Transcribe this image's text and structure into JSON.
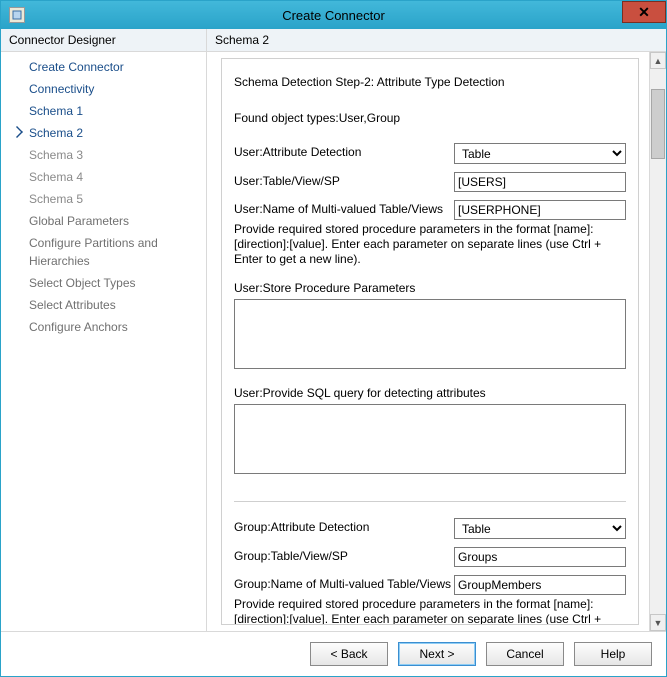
{
  "window": {
    "title": "Create Connector"
  },
  "headers": {
    "left": "Connector Designer",
    "right": "Schema 2"
  },
  "sidebar": {
    "items": [
      {
        "label": "Create Connector",
        "kind": "link"
      },
      {
        "label": "Connectivity",
        "kind": "link"
      },
      {
        "label": "Schema 1",
        "kind": "link"
      },
      {
        "label": "Schema 2",
        "kind": "active"
      },
      {
        "label": "Schema 3",
        "kind": "sub"
      },
      {
        "label": "Schema 4",
        "kind": "sub"
      },
      {
        "label": "Schema 5",
        "kind": "sub"
      },
      {
        "label": "Global Parameters",
        "kind": "dim"
      },
      {
        "label": "Configure Partitions and Hierarchies",
        "kind": "dim"
      },
      {
        "label": "Select Object Types",
        "kind": "dim"
      },
      {
        "label": "Select Attributes",
        "kind": "dim"
      },
      {
        "label": "Configure Anchors",
        "kind": "dim"
      }
    ]
  },
  "content": {
    "step_title": "Schema Detection Step-2: Attribute Type Detection",
    "found": "Found object types:User,Group",
    "user": {
      "attr_detection_label": "User:Attribute Detection",
      "attr_detection_value": "Table",
      "table_label": "User:Table/View/SP",
      "table_value": "[USERS]",
      "multi_label": "User:Name of Multi-valued Table/Views",
      "multi_value": "[USERPHONE]",
      "hint": "Provide required stored procedure parameters in the format [name]:[direction]:[value]. Enter each parameter on separate lines (use Ctrl + Enter to get a new line).",
      "sp_label": "User:Store Procedure Parameters",
      "sp_value": "",
      "sql_label": "User:Provide SQL query for detecting attributes",
      "sql_value": ""
    },
    "group": {
      "attr_detection_label": "Group:Attribute Detection",
      "attr_detection_value": "Table",
      "table_label": "Group:Table/View/SP",
      "table_value": "Groups",
      "multi_label": "Group:Name of Multi-valued Table/Views",
      "multi_value": "GroupMembers",
      "hint": "Provide required stored procedure parameters in the format [name]:[direction]:[value]. Enter each parameter on separate lines (use Ctrl + Enter to get a new line)."
    }
  },
  "footer": {
    "back": "<  Back",
    "next": "Next  >",
    "cancel": "Cancel",
    "help": "Help"
  }
}
